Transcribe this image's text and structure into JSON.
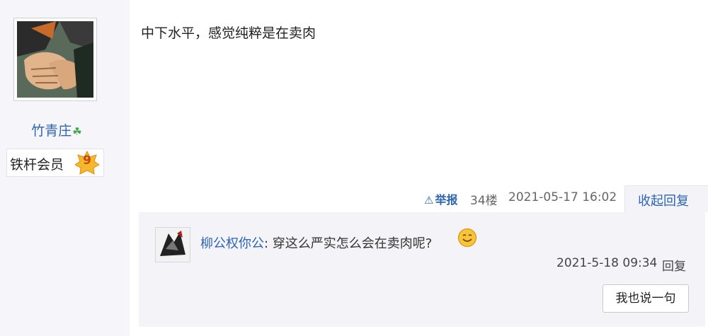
{
  "author": {
    "username": "竹青庄",
    "clover_icon": "clover-icon",
    "member_title": "铁杆会员",
    "level": "9"
  },
  "post": {
    "content": "中下水平，感觉纯粹是在卖肉",
    "report_label": "举报",
    "floor": "34楼",
    "time": "2021-05-17 16:02",
    "collapse_label": "收起回复"
  },
  "reply": {
    "username": "柳公权你公",
    "separator": ":",
    "content": " 穿这么严实怎么会在卖肉呢?",
    "time": "2021-5-18 09:34",
    "reply_label": "回复",
    "say_button": "我也说一句"
  },
  "colors": {
    "link": "#2d64b3",
    "background": "#f6f6fa",
    "reply_bg": "#f4f4f8"
  }
}
